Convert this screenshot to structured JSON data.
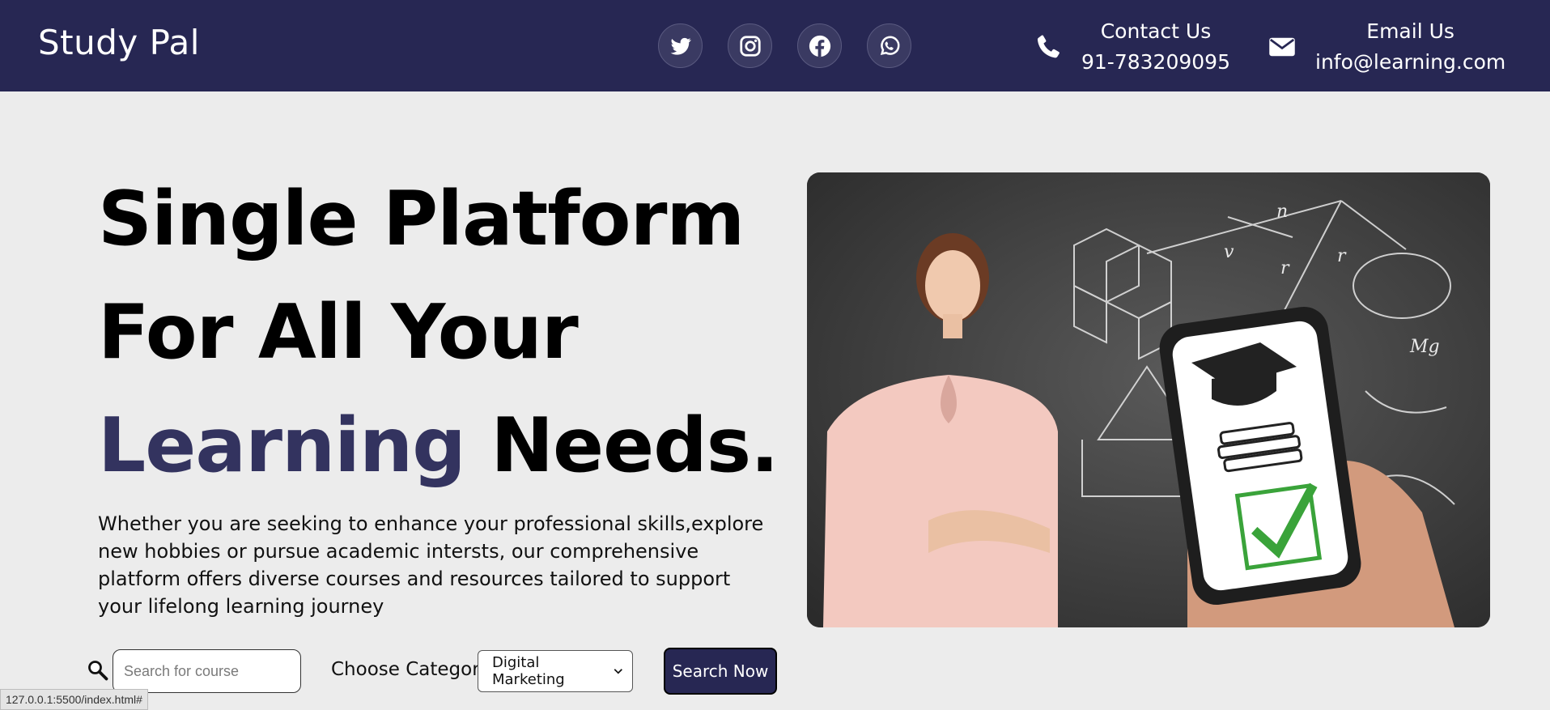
{
  "header": {
    "brand": "Study Pal",
    "socials": [
      {
        "name": "twitter-icon"
      },
      {
        "name": "instagram-icon"
      },
      {
        "name": "facebook-icon"
      },
      {
        "name": "whatsapp-icon"
      }
    ],
    "contact": {
      "label": "Contact Us",
      "value": "91-783209095"
    },
    "email": {
      "label": "Email Us",
      "value": "info@learning.com"
    }
  },
  "hero": {
    "headline_line1": "Single Platform",
    "headline_line2": "For All Your",
    "headline_accent": "Learning",
    "headline_end": " Needs.",
    "description": "Whether you are seeking to enhance your professional skills,explore new hobbies or pursue academic intersts, our comprehensive platform offers diverse courses and resources tailored to support your lifelong learning journey"
  },
  "search": {
    "placeholder": "Search for course",
    "category_label": "Choose Category",
    "category_selected": "Digital Marketing",
    "button_label": "Search Now"
  },
  "status_bar": {
    "url": "127.0.0.1:5500/index.html#"
  },
  "colors": {
    "header_bg": "#272753",
    "accent": "#33335f",
    "page_bg": "#ececec"
  }
}
